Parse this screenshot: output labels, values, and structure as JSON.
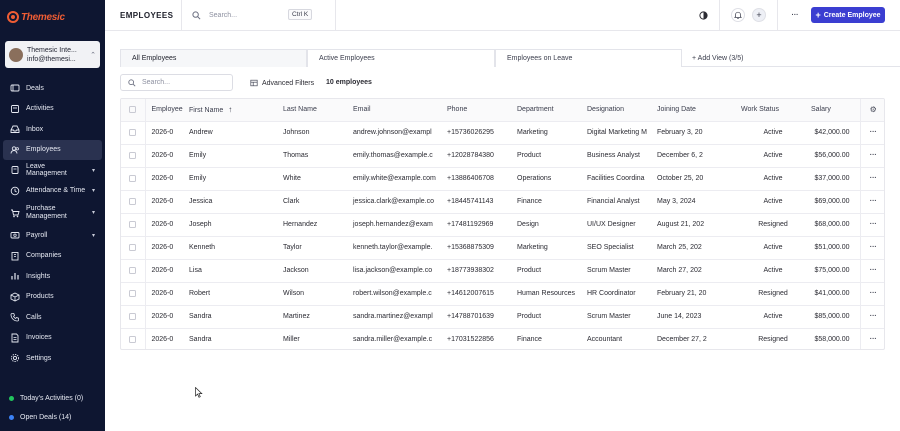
{
  "brand": {
    "logo_text": "Themesic",
    "accent": "#ef5d34"
  },
  "user": {
    "name": "Themesic Inte...",
    "email": "info@themesi..."
  },
  "sidebar": {
    "items": [
      {
        "label": "Deals",
        "icon": "deals-icon",
        "caret": false
      },
      {
        "label": "Activities",
        "icon": "activities-icon",
        "caret": false
      },
      {
        "label": "Inbox",
        "icon": "inbox-icon",
        "caret": false
      },
      {
        "label": "Employees",
        "icon": "employees-icon",
        "caret": false,
        "active": true
      },
      {
        "label": "Leave Management",
        "icon": "leave-icon",
        "caret": true
      },
      {
        "label": "Attendance & Time",
        "icon": "attendance-icon",
        "caret": true
      },
      {
        "label": "Purchase Management",
        "icon": "purchase-icon",
        "caret": true
      },
      {
        "label": "Payroll",
        "icon": "payroll-icon",
        "caret": true
      },
      {
        "label": "Companies",
        "icon": "companies-icon",
        "caret": false
      },
      {
        "label": "Insights",
        "icon": "insights-icon",
        "caret": false
      },
      {
        "label": "Products",
        "icon": "products-icon",
        "caret": false
      },
      {
        "label": "Calls",
        "icon": "calls-icon",
        "caret": false
      },
      {
        "label": "Invoices",
        "icon": "invoices-icon",
        "caret": false
      },
      {
        "label": "Settings",
        "icon": "settings-icon",
        "caret": false
      }
    ],
    "bottom": [
      {
        "label": "Today's Activities (0)",
        "color": "#22c55e"
      },
      {
        "label": "Open Deals (14)",
        "color": "#3b82f6"
      }
    ]
  },
  "topbar": {
    "title": "EMPLOYEES",
    "search_placeholder": "Search...",
    "shortcut": "Ctrl K",
    "create_label": "Create Employee",
    "create_color": "#3b3ed1"
  },
  "tabs": [
    "All Employees",
    "Active Employees",
    "Employees on Leave"
  ],
  "add_view": "+ Add View (3/5)",
  "toolbar": {
    "search_placeholder": "Search...",
    "filters_label": "Advanced Filters",
    "count_label": "10 employees"
  },
  "table": {
    "columns": [
      "Employee",
      "First Name",
      "Last Name",
      "Email",
      "Phone",
      "Department",
      "Designation",
      "Joining Date",
      "Work Status",
      "Salary"
    ],
    "rows": [
      [
        "2026-0",
        "Andrew",
        "Johnson",
        "andrew.johnson@exampl",
        "+15736026295",
        "Marketing",
        "Digital Marketing M",
        "February 3, 20",
        "Active",
        "$42,000.00"
      ],
      [
        "2026-0",
        "Emily",
        "Thomas",
        "emily.thomas@example.c",
        "+12028784380",
        "Product",
        "Business Analyst",
        "December 6, 2",
        "Active",
        "$56,000.00"
      ],
      [
        "2026-0",
        "Emily",
        "White",
        "emily.white@example.com",
        "+13886406708",
        "Operations",
        "Facilities Coordina",
        "October 25, 20",
        "Active",
        "$37,000.00"
      ],
      [
        "2026-0",
        "Jessica",
        "Clark",
        "jessica.clark@example.co",
        "+18445741143",
        "Finance",
        "Financial Analyst",
        "May 3, 2024",
        "Active",
        "$69,000.00"
      ],
      [
        "2026-0",
        "Joseph",
        "Hernandez",
        "joseph.hernandez@exam",
        "+17481192969",
        "Design",
        "UI/UX Designer",
        "August 21, 202",
        "Resigned",
        "$68,000.00"
      ],
      [
        "2026-0",
        "Kenneth",
        "Taylor",
        "kenneth.taylor@example.",
        "+15368875309",
        "Marketing",
        "SEO Specialist",
        "March 25, 202",
        "Active",
        "$51,000.00"
      ],
      [
        "2026-0",
        "Lisa",
        "Jackson",
        "lisa.jackson@example.co",
        "+18773938302",
        "Product",
        "Scrum Master",
        "March 27, 202",
        "Active",
        "$75,000.00"
      ],
      [
        "2026-0",
        "Robert",
        "Wilson",
        "robert.wilson@example.c",
        "+14612007615",
        "Human Resources",
        "HR Coordinator",
        "February 21, 20",
        "Resigned",
        "$41,000.00"
      ],
      [
        "2026-0",
        "Sandra",
        "Martinez",
        "sandra.martinez@exampl",
        "+14788701639",
        "Product",
        "Scrum Master",
        "June 14, 2023",
        "Active",
        "$85,000.00"
      ],
      [
        "2026-0",
        "Sandra",
        "Miller",
        "sandra.miller@example.c",
        "+17031522856",
        "Finance",
        "Accountant",
        "December 27, 2",
        "Resigned",
        "$58,000.00"
      ]
    ]
  }
}
